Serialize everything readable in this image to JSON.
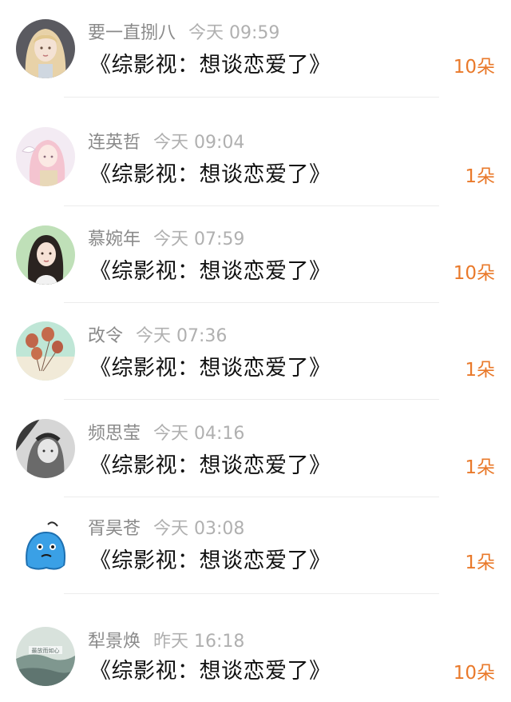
{
  "entries": [
    {
      "name": "要一直捌八",
      "time": "今天 09:59",
      "title": "《综影视：想谈恋爱了》",
      "count": "10朵",
      "avatar_icon": "girl-avatar-icon",
      "avatar_color": "#e9dcc8"
    },
    {
      "name": "连英哲",
      "time": "今天 09:04",
      "title": "《综影视：想谈恋爱了》",
      "count": "1朵",
      "avatar_icon": "anime-girl-avatar-icon",
      "avatar_color": "#f1e4ee"
    },
    {
      "name": "慕婉年",
      "time": "今天 07:59",
      "title": "《综影视：想谈恋爱了》",
      "count": "10朵",
      "avatar_icon": "woman-portrait-avatar-icon",
      "avatar_color": "#cfe3c8"
    },
    {
      "name": "改令",
      "time": "今天 07:36",
      "title": "《综影视：想谈恋爱了》",
      "count": "1朵",
      "avatar_icon": "balloons-avatar-icon",
      "avatar_color": "#bfe6d6"
    },
    {
      "name": "频思莹",
      "time": "今天 04:16",
      "title": "《综影视：想谈恋爱了》",
      "count": "1朵",
      "avatar_icon": "bw-child-avatar-icon",
      "avatar_color": "#9a9a9a"
    },
    {
      "name": "胥昊苍",
      "time": "今天 03:08",
      "title": "《综影视：想谈恋爱了》",
      "count": "1朵",
      "avatar_icon": "blue-cartoon-avatar-icon",
      "avatar_color": "#3aa0e6"
    },
    {
      "name": "犁景焕",
      "time": "昨天 16:18",
      "title": "《综影视：想谈恋爱了》",
      "count": "10朵",
      "avatar_icon": "landscape-avatar-icon",
      "avatar_color": "#8fa8a0"
    }
  ],
  "avatar_text_7": "最放而如心"
}
